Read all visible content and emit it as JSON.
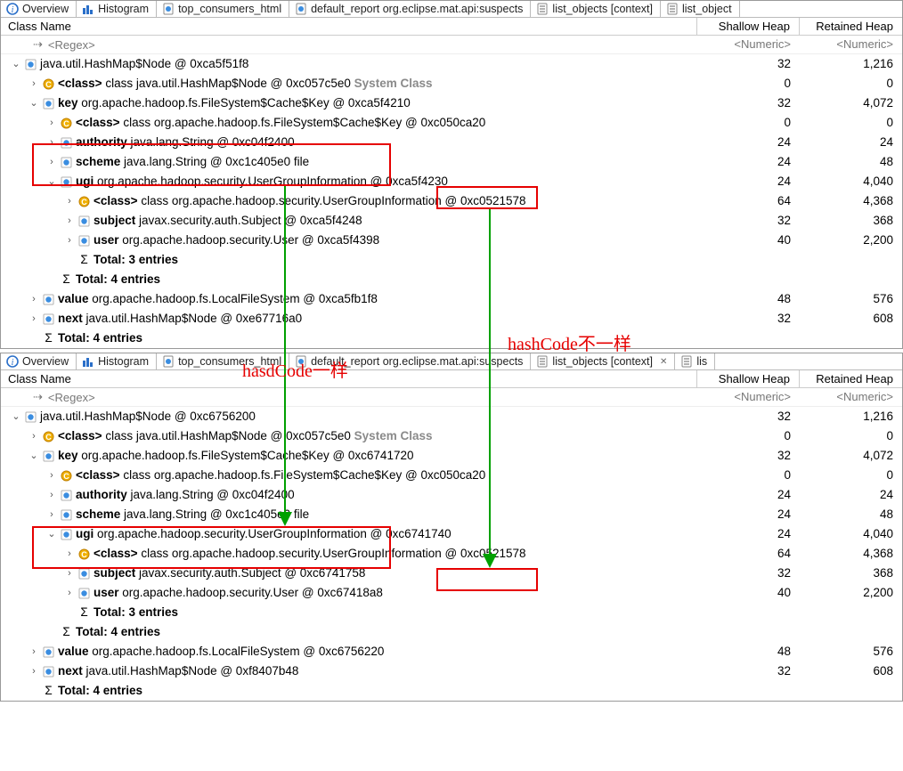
{
  "tabs_top": [
    {
      "label": "Overview",
      "icon": "info"
    },
    {
      "label": "Histogram",
      "icon": "hist"
    },
    {
      "label": "top_consumers_html",
      "icon": "doc"
    },
    {
      "label": "default_report  org.eclipse.mat.api:suspects",
      "icon": "doc"
    },
    {
      "label": "list_objects [context]",
      "icon": "list",
      "active": true
    },
    {
      "label": "list_object",
      "icon": "list"
    }
  ],
  "tabs_bottom": [
    {
      "label": "Overview",
      "icon": "info"
    },
    {
      "label": "Histogram",
      "icon": "hist"
    },
    {
      "label": "top_consumers_html",
      "icon": "doc"
    },
    {
      "label": "default_report  org.eclipse.mat.api:suspects",
      "icon": "doc"
    },
    {
      "label": "list_objects [context]",
      "icon": "list",
      "active": true,
      "closable": true
    },
    {
      "label": "lis",
      "icon": "list"
    }
  ],
  "headers": {
    "name": "Class Name",
    "shallow": "Shallow Heap",
    "retained": "Retained Heap"
  },
  "filter": {
    "regex": "<Regex>",
    "numeric": "<Numeric>"
  },
  "rows_top": [
    {
      "depth": 0,
      "tw": "v",
      "ico": "obj",
      "pre": "",
      "bold": "",
      "text": "java.util.HashMap$Node @ 0xca5f51f8",
      "sh": "32",
      "rh": "1,216"
    },
    {
      "depth": 1,
      "tw": ">",
      "ico": "cls",
      "pre": "",
      "bold": "<class>",
      "text": " class java.util.HashMap$Node @ 0xc057c5e0",
      "sys": " System Class",
      "sh": "0",
      "rh": "0"
    },
    {
      "depth": 1,
      "tw": "v",
      "ico": "obj",
      "pre": "",
      "bold": "key",
      "text": " org.apache.hadoop.fs.FileSystem$Cache$Key @ 0xca5f4210",
      "sh": "32",
      "rh": "4,072"
    },
    {
      "depth": 2,
      "tw": ">",
      "ico": "cls",
      "pre": "",
      "bold": "<class>",
      "text": " class org.apache.hadoop.fs.FileSystem$Cache$Key @ 0xc050ca20",
      "sh": "0",
      "rh": "0"
    },
    {
      "depth": 2,
      "tw": ">",
      "ico": "obj",
      "pre": "",
      "bold": "authority",
      "text": " java.lang.String @ 0xc04f2400",
      "sh": "24",
      "rh": "24"
    },
    {
      "depth": 2,
      "tw": ">",
      "ico": "obj",
      "pre": "",
      "bold": "scheme",
      "text": " java.lang.String @ 0xc1c405e0  file",
      "sh": "24",
      "rh": "48"
    },
    {
      "depth": 2,
      "tw": "v",
      "ico": "obj",
      "pre": "",
      "bold": "ugi",
      "text": " org.apache.hadoop.security.UserGroupInformation @ 0xca5f4230",
      "sh": "24",
      "rh": "4,040"
    },
    {
      "depth": 3,
      "tw": ">",
      "ico": "cls",
      "pre": "",
      "bold": "<class>",
      "text": " class org.apache.hadoop.security.UserGroupInformation @ 0xc0521578",
      "sh": "64",
      "rh": "4,368"
    },
    {
      "depth": 3,
      "tw": ">",
      "ico": "obj",
      "pre": "",
      "bold": "subject",
      "text": " javax.security.auth.Subject @ 0xca5f4248",
      "sh": "32",
      "rh": "368"
    },
    {
      "depth": 3,
      "tw": ">",
      "ico": "obj",
      "pre": "",
      "bold": "user",
      "text": " org.apache.hadoop.security.User @ 0xca5f4398",
      "sh": "40",
      "rh": "2,200"
    },
    {
      "depth": 3,
      "tw": "",
      "ico": "sum",
      "pre": "",
      "bold": "Total: 3 entries",
      "text": "",
      "sh": "",
      "rh": ""
    },
    {
      "depth": 2,
      "tw": "",
      "ico": "sum",
      "pre": "",
      "bold": "Total: 4 entries",
      "text": "",
      "sh": "",
      "rh": ""
    },
    {
      "depth": 1,
      "tw": ">",
      "ico": "obj",
      "pre": "",
      "bold": "value",
      "text": " org.apache.hadoop.fs.LocalFileSystem @ 0xca5fb1f8",
      "sh": "48",
      "rh": "576"
    },
    {
      "depth": 1,
      "tw": ">",
      "ico": "obj",
      "pre": "",
      "bold": "next",
      "text": " java.util.HashMap$Node @ 0xe67716a0",
      "sh": "32",
      "rh": "608"
    },
    {
      "depth": 1,
      "tw": "",
      "ico": "sum",
      "pre": "",
      "bold": "Total: 4 entries",
      "text": "",
      "sh": "",
      "rh": ""
    }
  ],
  "rows_bottom": [
    {
      "depth": 0,
      "tw": "v",
      "ico": "obj",
      "bold": "",
      "text": "java.util.HashMap$Node @ 0xc6756200",
      "sh": "32",
      "rh": "1,216"
    },
    {
      "depth": 1,
      "tw": ">",
      "ico": "cls",
      "bold": "<class>",
      "text": " class java.util.HashMap$Node @ 0xc057c5e0",
      "sys": " System Class",
      "sh": "0",
      "rh": "0"
    },
    {
      "depth": 1,
      "tw": "v",
      "ico": "obj",
      "bold": "key",
      "text": " org.apache.hadoop.fs.FileSystem$Cache$Key @ 0xc6741720",
      "sh": "32",
      "rh": "4,072"
    },
    {
      "depth": 2,
      "tw": ">",
      "ico": "cls",
      "bold": "<class>",
      "text": " class org.apache.hadoop.fs.FileSystem$Cache$Key @ 0xc050ca20",
      "sh": "0",
      "rh": "0"
    },
    {
      "depth": 2,
      "tw": ">",
      "ico": "obj",
      "bold": "authority",
      "text": " java.lang.String @ 0xc04f2400",
      "sh": "24",
      "rh": "24"
    },
    {
      "depth": 2,
      "tw": ">",
      "ico": "obj",
      "bold": "scheme",
      "text": " java.lang.String @ 0xc1c405e0  file",
      "sh": "24",
      "rh": "48"
    },
    {
      "depth": 2,
      "tw": "v",
      "ico": "obj",
      "bold": "ugi",
      "text": " org.apache.hadoop.security.UserGroupInformation @ 0xc6741740",
      "sh": "24",
      "rh": "4,040"
    },
    {
      "depth": 3,
      "tw": ">",
      "ico": "cls",
      "bold": "<class>",
      "text": " class org.apache.hadoop.security.UserGroupInformation @ 0xc0521578",
      "sh": "64",
      "rh": "4,368"
    },
    {
      "depth": 3,
      "tw": ">",
      "ico": "obj",
      "bold": "subject",
      "text": " javax.security.auth.Subject @ 0xc6741758",
      "sh": "32",
      "rh": "368"
    },
    {
      "depth": 3,
      "tw": ">",
      "ico": "obj",
      "bold": "user",
      "text": " org.apache.hadoop.security.User @ 0xc67418a8",
      "sh": "40",
      "rh": "2,200"
    },
    {
      "depth": 3,
      "tw": "",
      "ico": "sum",
      "bold": "Total: 3 entries",
      "text": "",
      "sh": "",
      "rh": ""
    },
    {
      "depth": 2,
      "tw": "",
      "ico": "sum",
      "bold": "Total: 4 entries",
      "text": "",
      "sh": "",
      "rh": ""
    },
    {
      "depth": 1,
      "tw": ">",
      "ico": "obj",
      "bold": "value",
      "text": " org.apache.hadoop.fs.LocalFileSystem @ 0xc6756220",
      "sh": "48",
      "rh": "576"
    },
    {
      "depth": 1,
      "tw": ">",
      "ico": "obj",
      "bold": "next",
      "text": " java.util.HashMap$Node @ 0xf8407b48",
      "sh": "32",
      "rh": "608"
    },
    {
      "depth": 1,
      "tw": "",
      "ico": "sum",
      "bold": "Total: 4 entries",
      "text": "",
      "sh": "",
      "rh": ""
    }
  ],
  "annotations": {
    "same": "hasdCode一样",
    "diff": "hashCode不一样"
  }
}
